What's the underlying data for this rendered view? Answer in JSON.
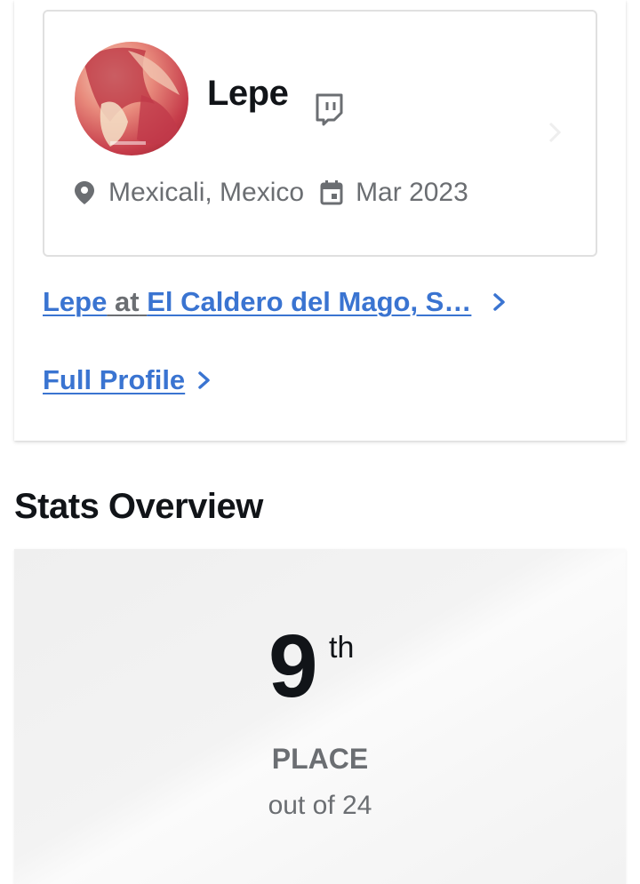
{
  "profile": {
    "name": "Lepe",
    "location": "Mexicali, Mexico",
    "joined": "Mar 2023",
    "avatar_icon": "avatar-image",
    "social_icon": "twitch-icon"
  },
  "links": {
    "entrant_name": "Lepe",
    "at_word": "at",
    "event_name": "El Caldero del Mago, S…",
    "full_profile": "Full Profile"
  },
  "stats": {
    "section_title": "Stats Overview",
    "place_number": "9",
    "place_suffix": "th",
    "place_label": "PLACE",
    "out_of": "out of 24"
  },
  "colors": {
    "link": "#3a74d1",
    "text_dark": "#111418",
    "text_muted": "#6b6e72"
  }
}
